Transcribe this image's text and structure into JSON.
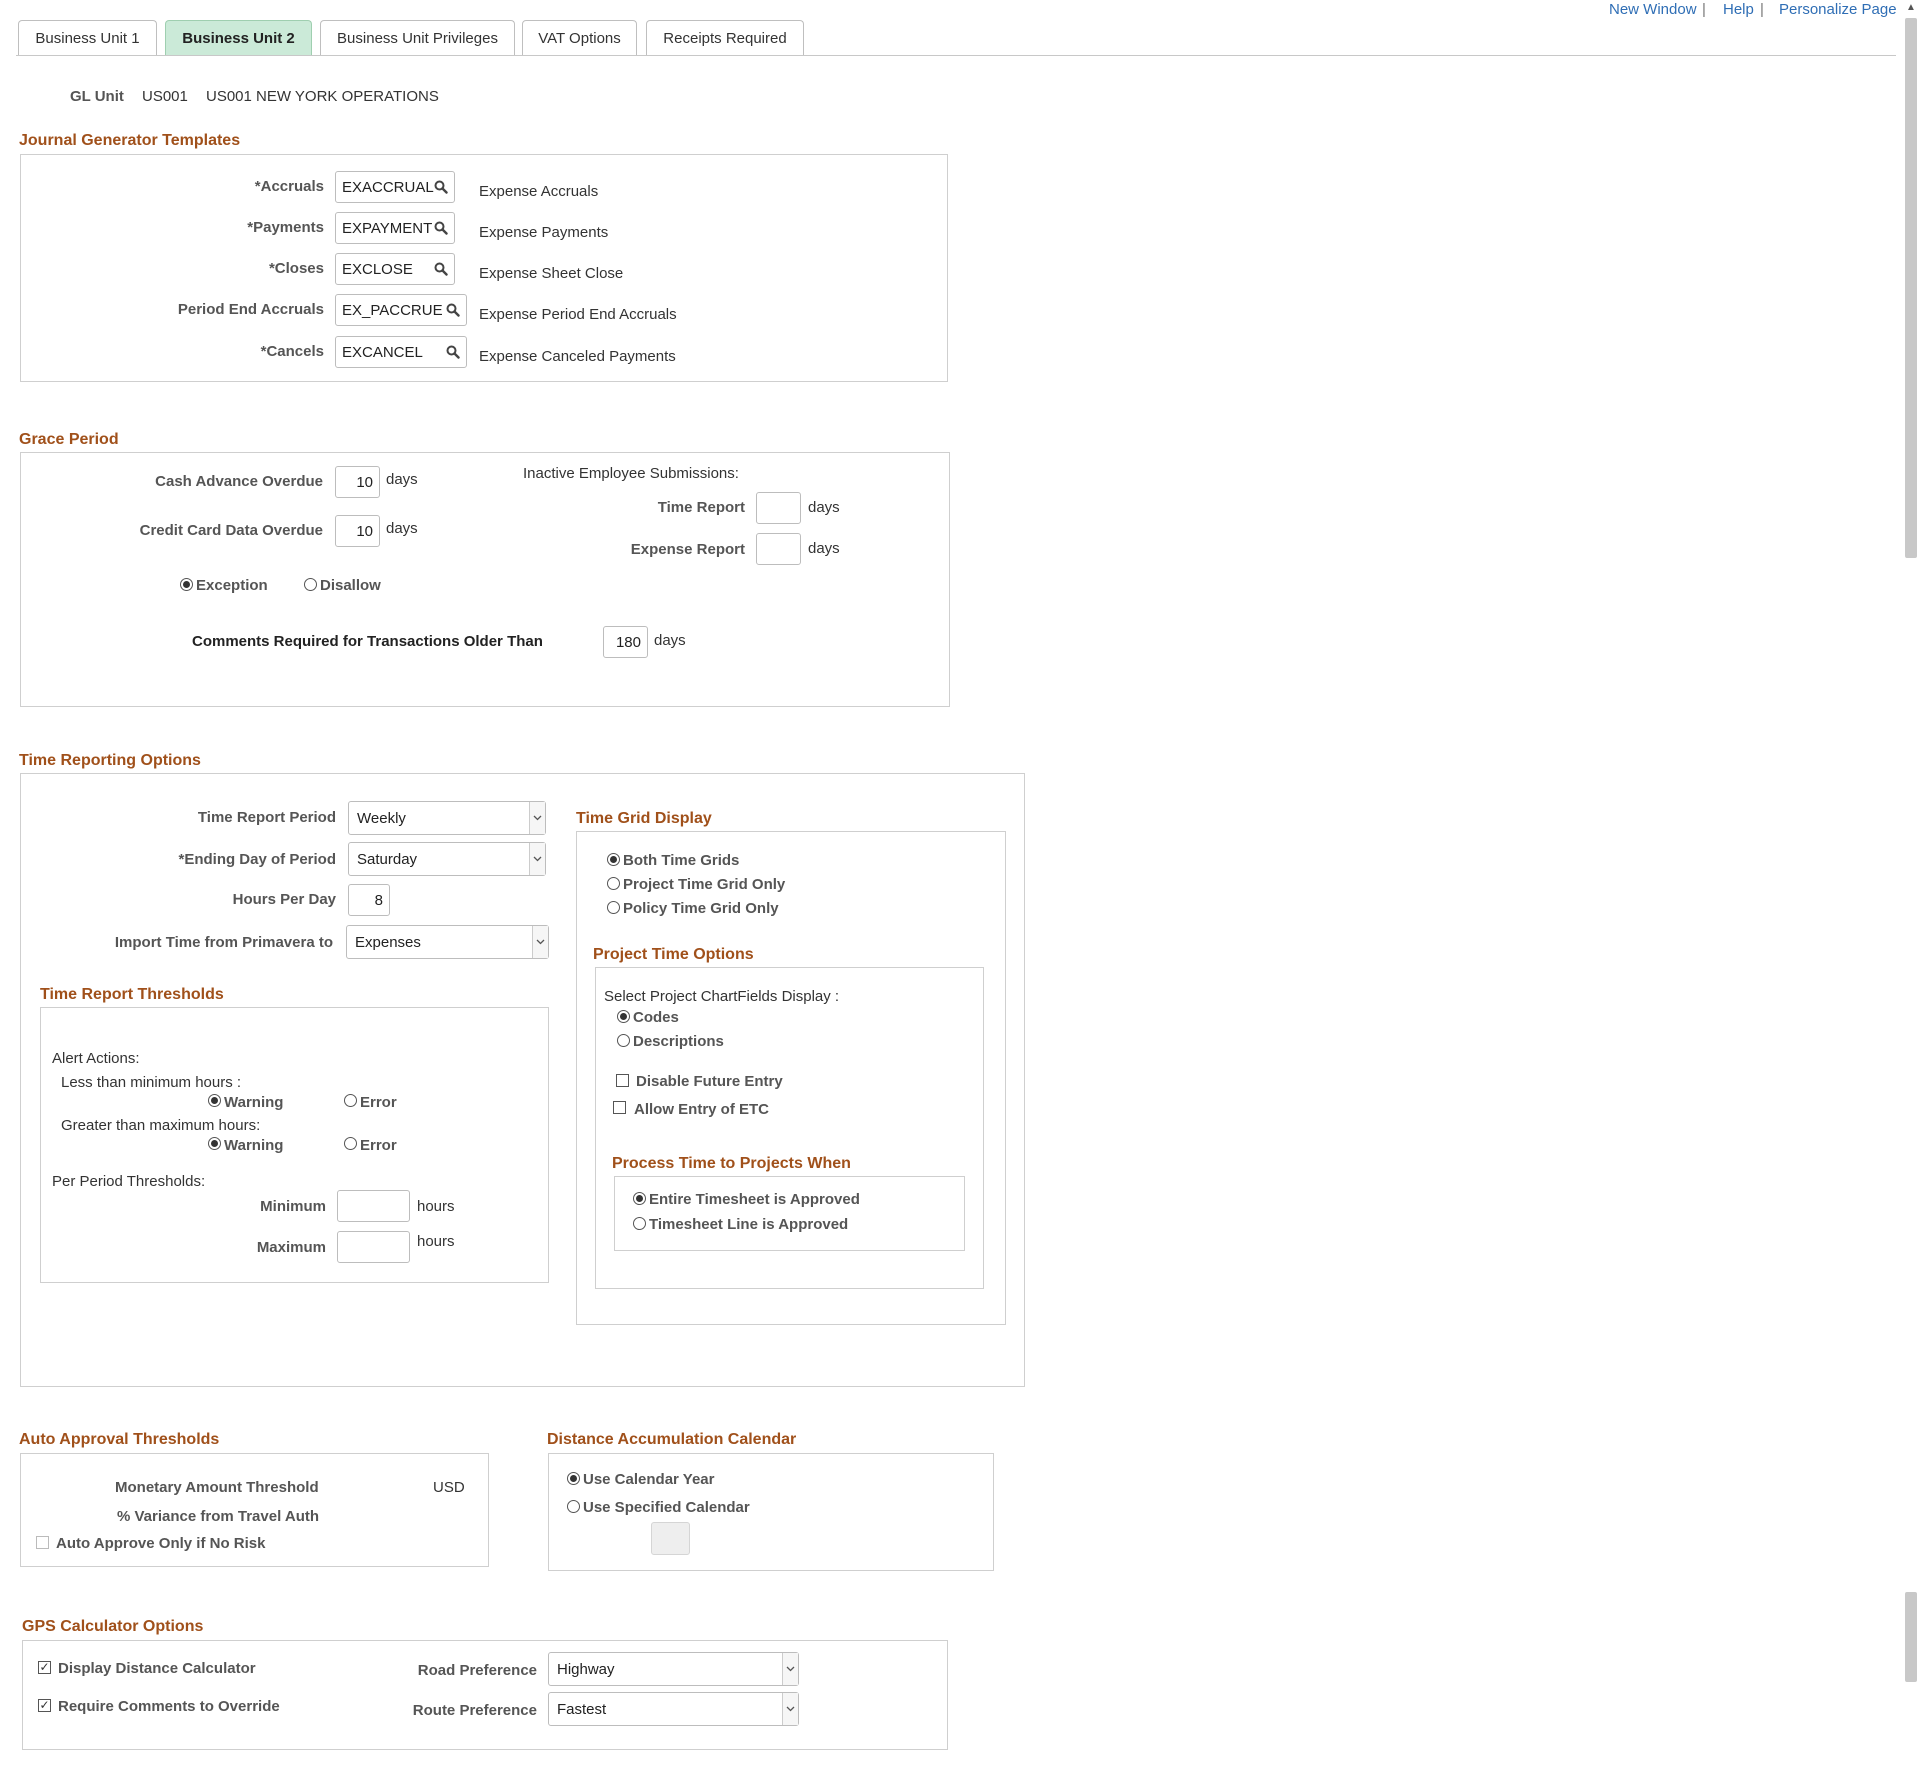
{
  "tabs": [
    {
      "label": "Business Unit 1",
      "active": false
    },
    {
      "label": "Business Unit 2",
      "active": true
    },
    {
      "label": "Business Unit Privileges",
      "active": false
    },
    {
      "label": "VAT Options",
      "active": false
    },
    {
      "label": "Receipts Required",
      "active": false
    }
  ],
  "top_links": {
    "new_window": "New Window",
    "help": "Help",
    "personalize": "Personalize Page",
    "separator": "|"
  },
  "gl_unit": {
    "label": "GL Unit",
    "code": "US001",
    "description": "US001 NEW YORK OPERATIONS"
  },
  "journal_generator": {
    "title": "Journal Generator Templates",
    "rows": [
      {
        "label": "*Accruals",
        "value": "EXACCRUAL",
        "description": "Expense Accruals"
      },
      {
        "label": "*Payments",
        "value": "EXPAYMENT",
        "description": "Expense Payments"
      },
      {
        "label": "*Closes",
        "value": "EXCLOSE",
        "description": "Expense Sheet Close"
      },
      {
        "label": "Period End Accruals",
        "value": "EX_PACCRUE",
        "description": "Expense Period End Accruals"
      },
      {
        "label": "*Cancels",
        "value": "EXCANCEL",
        "description": "Expense Canceled Payments"
      }
    ]
  },
  "grace_period": {
    "title": "Grace Period",
    "cash_advance_label": "Cash Advance Overdue",
    "cash_advance_value": "10",
    "credit_card_label": "Credit Card Data Overdue",
    "credit_card_value": "10",
    "days": "days",
    "inactive_label": "Inactive Employee Submissions:",
    "time_report_label": "Time Report",
    "time_report_value": "",
    "expense_report_label": "Expense Report",
    "expense_report_value": "",
    "exception_label": "Exception",
    "disallow_label": "Disallow",
    "selected": "Exception",
    "comments_label": "Comments Required for Transactions Older Than",
    "comments_value": "180"
  },
  "time_reporting": {
    "title": "Time Reporting Options",
    "period_label": "Time Report Period",
    "period_value": "Weekly",
    "ending_day_label": "*Ending Day of Period",
    "ending_day_value": "Saturday",
    "hours_label": "Hours Per Day",
    "hours_value": "8",
    "import_label": "Import Time from Primavera to",
    "import_value": "Expenses",
    "thresholds": {
      "title": "Time Report Thresholds",
      "alert_actions": "Alert Actions:",
      "less_than_min": "Less than minimum hours :",
      "greater_than_max": "Greater than maximum hours:",
      "warning": "Warning",
      "error": "Error",
      "less_selected": "Warning",
      "greater_selected": "Warning",
      "per_period": "Per Period Thresholds:",
      "minimum_label": "Minimum",
      "minimum_value": "",
      "maximum_label": "Maximum",
      "maximum_value": "",
      "hours": "hours"
    },
    "time_grid": {
      "title": "Time Grid Display",
      "options": [
        "Both Time Grids",
        "Project Time Grid Only",
        "Policy Time Grid Only"
      ],
      "selected": "Both Time Grids"
    },
    "project_time": {
      "title": "Project Time Options",
      "chartfields_label": "Select Project ChartFields Display :",
      "options": [
        "Codes",
        "Descriptions"
      ],
      "selected": "Codes",
      "disable_future_entry": {
        "label": "Disable Future Entry",
        "checked": false
      },
      "allow_etc": {
        "label": "Allow Entry of ETC",
        "checked": false
      },
      "process_title": "Process Time to Projects When",
      "process_options": [
        "Entire Timesheet is Approved",
        "Timesheet Line is Approved"
      ],
      "process_selected": "Entire Timesheet is Approved"
    }
  },
  "auto_approval": {
    "title": "Auto Approval Thresholds",
    "monetary_label": "Monetary Amount Threshold",
    "currency": "USD",
    "variance_label": "% Variance from Travel Auth",
    "no_risk_label": "Auto Approve Only if No Risk",
    "no_risk_checked": false
  },
  "distance_calendar": {
    "title": "Distance Accumulation Calendar",
    "options": [
      "Use Calendar Year",
      "Use Specified Calendar"
    ],
    "selected": "Use Calendar Year",
    "calendar_value": ""
  },
  "gps": {
    "title": "GPS Calculator Options",
    "display_calc": {
      "label": "Display Distance Calculator",
      "checked": true
    },
    "require_comments": {
      "label": "Require Comments to Override",
      "checked": true
    },
    "road_label": "Road Preference",
    "road_value": "Highway",
    "route_label": "Route Preference",
    "route_value": "Fastest"
  },
  "icons": {
    "lookup": "search-icon",
    "dropdown": "chevron-down-icon",
    "check": "✓"
  }
}
